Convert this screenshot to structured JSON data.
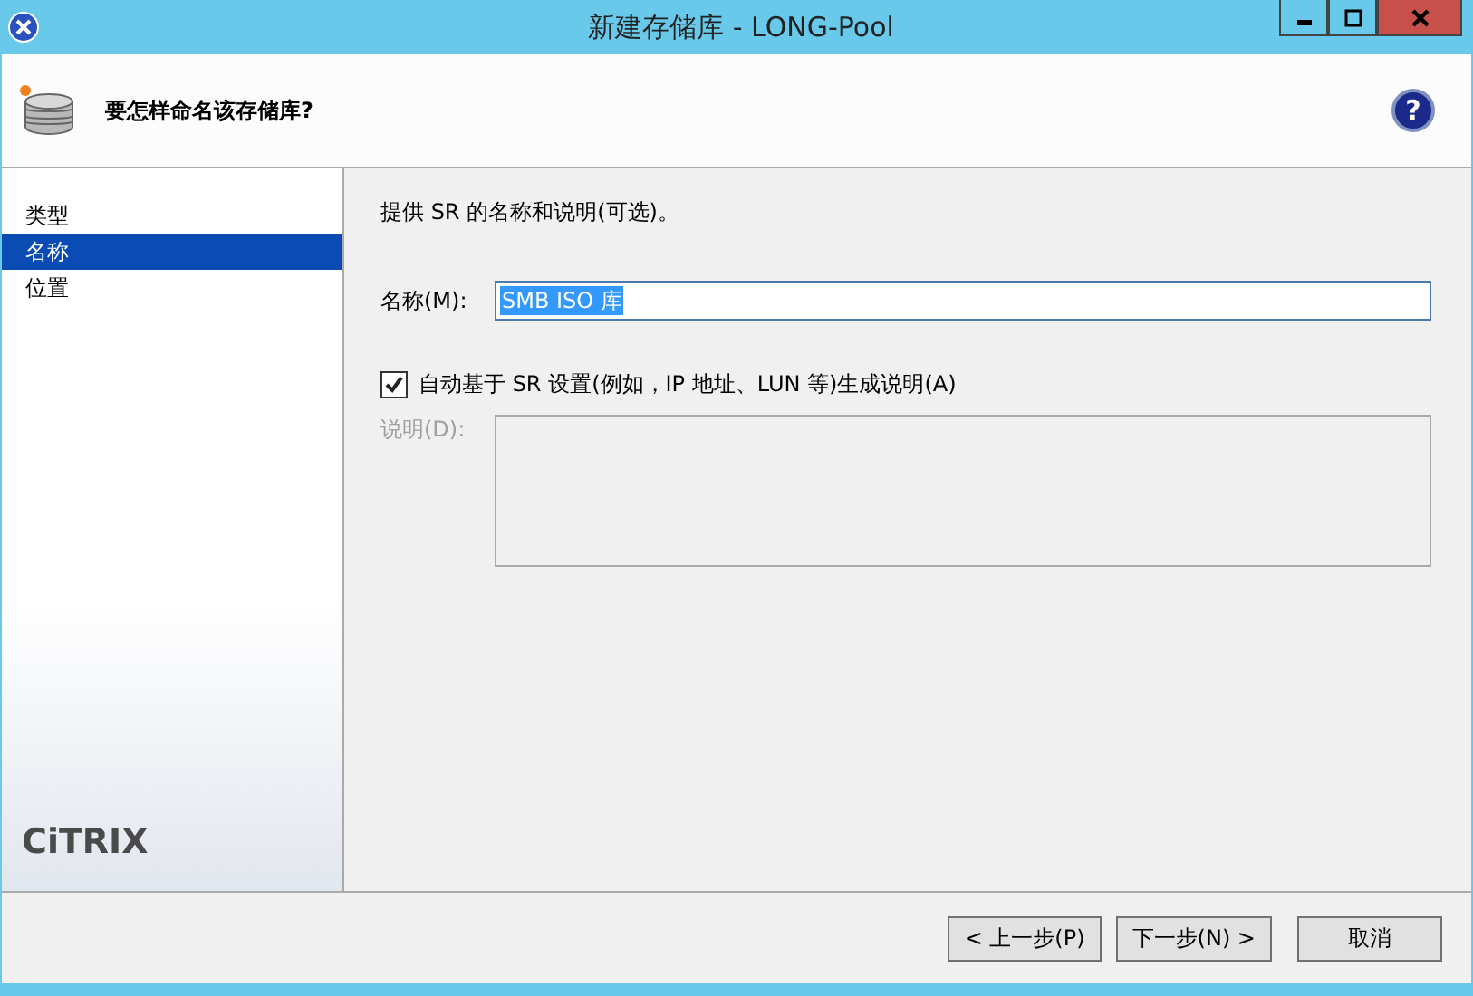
{
  "window": {
    "title": "新建存储库 - LONG-Pool"
  },
  "header": {
    "title": "要怎样命名该存储库?",
    "help": "?"
  },
  "sidebar": {
    "items": [
      {
        "label": "类型",
        "selected": false
      },
      {
        "label": "名称",
        "selected": true
      },
      {
        "label": "位置",
        "selected": false
      }
    ],
    "logo": "CiTRIX"
  },
  "main": {
    "intro": "提供 SR 的名称和说明(可选)。",
    "name_field": {
      "label": "名称(M):",
      "value": "SMB ISO 库"
    },
    "auto_checkbox": {
      "label": "自动基于 SR 设置(例如，IP 地址、LUN 等)生成说明(A)",
      "checked": true
    },
    "description_field": {
      "label": "说明(D):",
      "disabled": true
    }
  },
  "buttons": [
    {
      "label": "< 上一步(P)"
    },
    {
      "label": "下一步(N) >"
    },
    {
      "label": "取消"
    }
  ]
}
